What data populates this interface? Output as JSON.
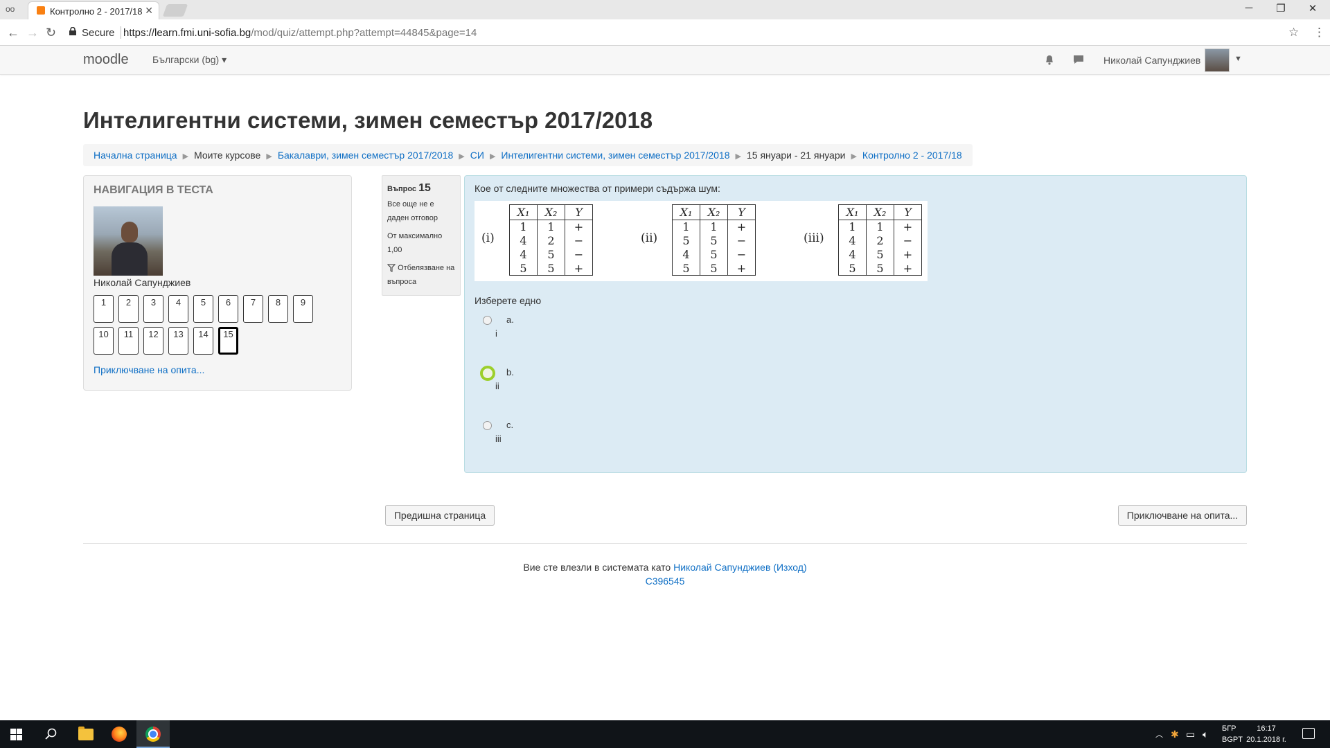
{
  "browser": {
    "tab_title": "Контролно 2 - 2017/18",
    "secure_label": "Secure",
    "url_host": "https://learn.fmi.uni-sofia.bg",
    "url_path": "/mod/quiz/attempt.php?attempt=44845&page=14"
  },
  "navbar": {
    "brand": "moodle",
    "language": "Български (bg) ▾",
    "user_name": "Николай Сапунджиев"
  },
  "page": {
    "title": "Интелигентни системи, зимен семестър 2017/2018",
    "breadcrumb": [
      {
        "label": "Начална страница",
        "link": true
      },
      {
        "label": "Моите курсове",
        "link": false
      },
      {
        "label": "Бакалаври, зимен семестър 2017/2018",
        "link": true
      },
      {
        "label": "СИ",
        "link": true
      },
      {
        "label": "Интелигентни системи, зимен семестър 2017/2018",
        "link": true
      },
      {
        "label": "15 януари - 21 януари",
        "link": false
      },
      {
        "label": "Контролно 2 - 2017/18",
        "link": true
      }
    ]
  },
  "quiz_nav": {
    "title": "НАВИГАЦИЯ В ТЕСТА",
    "user_name": "Николай Сапунджиев",
    "questions": [
      "1",
      "2",
      "3",
      "4",
      "5",
      "6",
      "7",
      "8",
      "9",
      "10",
      "11",
      "12",
      "13",
      "14",
      "15"
    ],
    "current": "15",
    "finish_link": "Приключване на опита..."
  },
  "question_info": {
    "label": "Въпрос",
    "number": "15",
    "state": "Все още не е даден отговор",
    "marks": "От максимално 1,00",
    "flag": "Отбелязване на въпроса"
  },
  "question": {
    "text": "Кое от следните множества от примери съдържа шум:",
    "tables": [
      {
        "label": "(i)",
        "headers": [
          "X₁",
          "X₂",
          "Y"
        ],
        "rows": [
          [
            "1",
            "1",
            "+"
          ],
          [
            "4",
            "2",
            "−"
          ],
          [
            "4",
            "5",
            "−"
          ],
          [
            "5",
            "5",
            "+"
          ]
        ]
      },
      {
        "label": "(ii)",
        "headers": [
          "X₁",
          "X₂",
          "Y"
        ],
        "rows": [
          [
            "1",
            "1",
            "+"
          ],
          [
            "5",
            "5",
            "−"
          ],
          [
            "4",
            "5",
            "−"
          ],
          [
            "5",
            "5",
            "+"
          ]
        ]
      },
      {
        "label": "(iii)",
        "headers": [
          "X₁",
          "X₂",
          "Y"
        ],
        "rows": [
          [
            "1",
            "1",
            "+"
          ],
          [
            "4",
            "2",
            "−"
          ],
          [
            "4",
            "5",
            "+"
          ],
          [
            "5",
            "5",
            "+"
          ]
        ]
      }
    ],
    "prompt": "Изберете едно",
    "options": [
      {
        "letter": "a.",
        "answer": "i",
        "checked": false
      },
      {
        "letter": "b.",
        "answer": "ii",
        "checked": true
      },
      {
        "letter": "c.",
        "answer": "iii",
        "checked": false
      }
    ]
  },
  "buttons": {
    "previous": "Предишна страница",
    "finish": "Приключване на опита..."
  },
  "footer": {
    "logged_in_prefix": "Вие сте влезли в системата като",
    "user_name": "Николай Сапунджиев",
    "logout": "(Изход)",
    "code": "C396545"
  },
  "taskbar": {
    "lang_line1": "БГР",
    "lang_line2": "BGPT",
    "time": "16:17",
    "date": "20.1.2018 г."
  },
  "colors": {
    "link": "#0f6fc5",
    "question_bg": "#dcebf4",
    "radio_focus": "#9ccf2b"
  }
}
